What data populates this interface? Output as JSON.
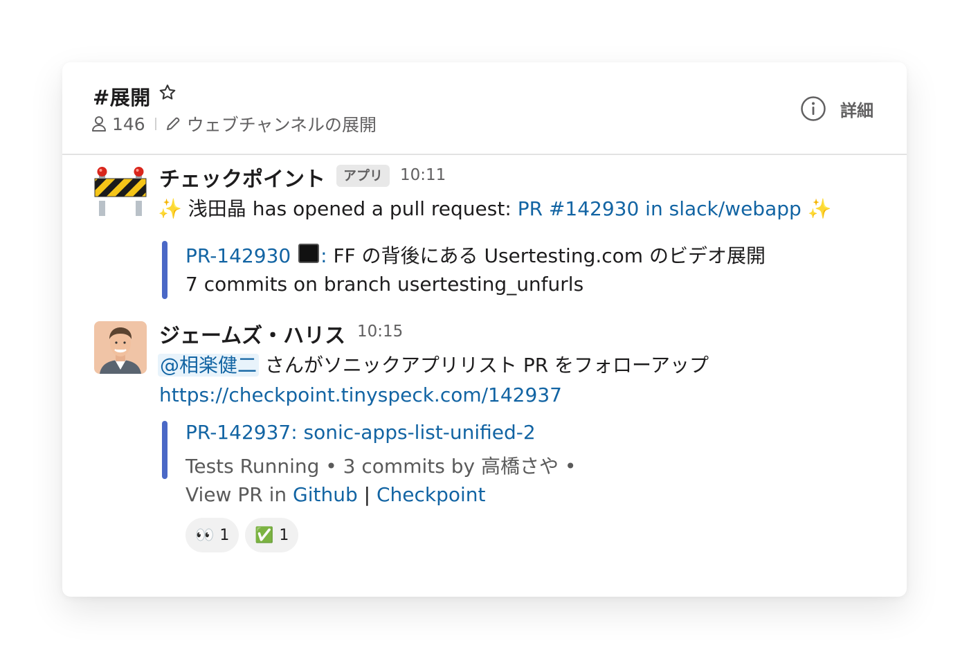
{
  "channel": {
    "name": "#展開",
    "member_count": "146",
    "topic": "ウェブチャンネルの展開",
    "details_label": "詳細",
    "icons": [
      "star-icon",
      "person-icon",
      "pencil-icon",
      "info-icon"
    ]
  },
  "messages": [
    {
      "author": "チェックポイント",
      "badge": "アプリ",
      "time": "10:11",
      "avatar": "construction-barrier-emoji",
      "text": {
        "sparkle_left": "✨",
        "user": "浅田晶",
        "action": " has opened a pull request: ",
        "pr_link": "PR #142930 in slack/webapp",
        "sparkle_right": "✨"
      },
      "attachment": {
        "title_link": "PR-142930",
        "title_colon": ":",
        "title_rest": " FF の背後にある Usertesting.com のビデオ展開",
        "subtitle": "7 commits on branch usertesting_unfurls"
      }
    },
    {
      "author": "ジェームズ・ハリス",
      "time": "10:15",
      "avatar": "person-photo",
      "text": {
        "mention": "@相楽健二",
        "body": " さんがソニックアプリリスト PR をフォローアップ",
        "url": "https://checkpoint.tinyspeck.com/142937"
      },
      "attachment": {
        "title": "PR-142937: sonic-apps-list-unified-2",
        "status": "Tests Running • 3 commits by 高橋さや •",
        "view_prefix": "View PR in ",
        "github": "Github",
        "divider": " | ",
        "checkpoint": "Checkpoint"
      },
      "reactions": [
        {
          "emoji": "👀",
          "icon": "eyes-emoji",
          "count": "1"
        },
        {
          "emoji": "✅",
          "icon": "check-mark-emoji",
          "count": "1"
        }
      ]
    }
  ],
  "colors": {
    "link": "#1264a3",
    "attachment_bar": "#4a68c6",
    "muted": "#616061"
  }
}
